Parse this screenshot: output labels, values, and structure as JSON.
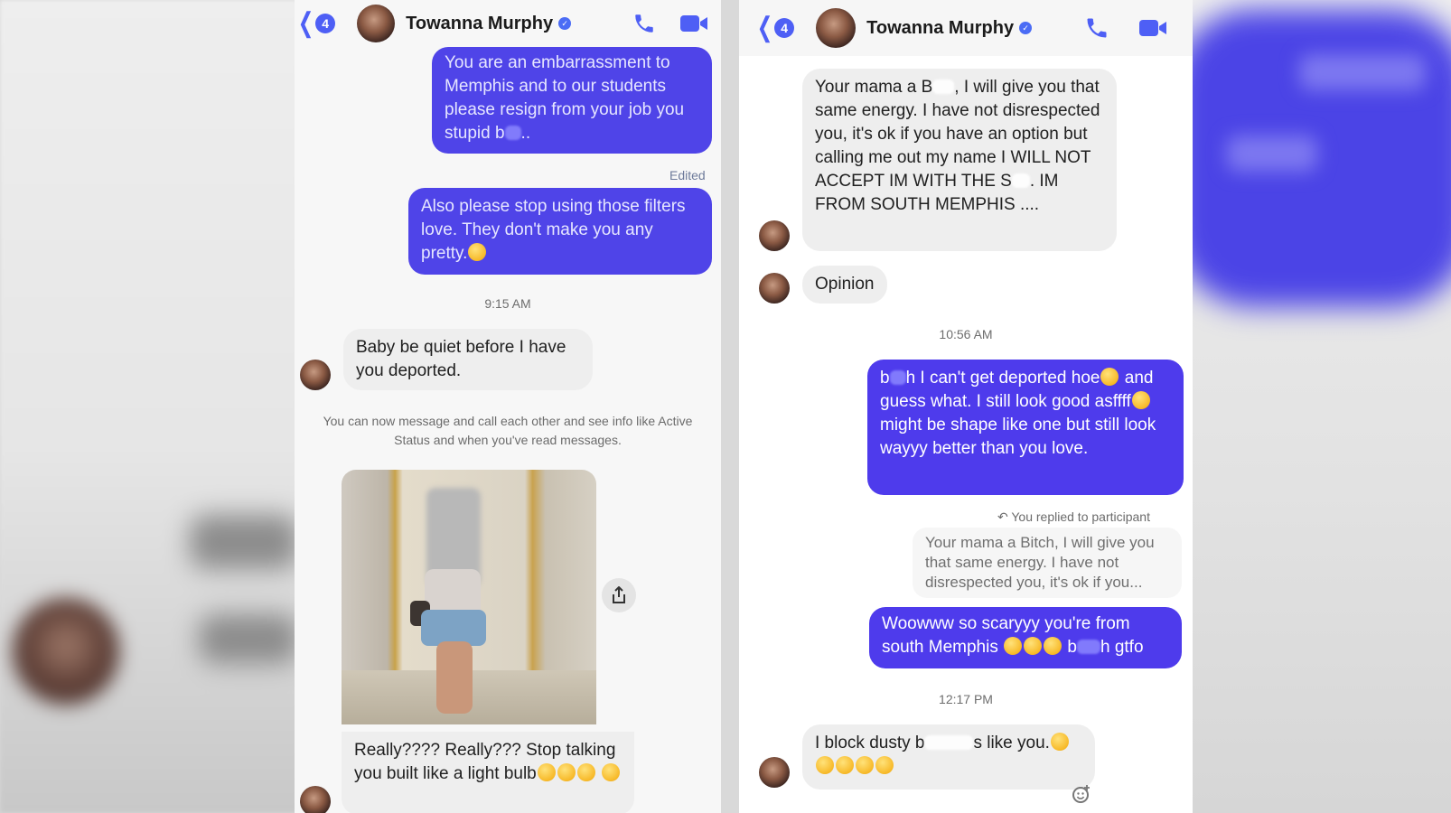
{
  "left_panel": {
    "header": {
      "back_count": "4",
      "name": "Towanna Murphy"
    },
    "messages": {
      "out1": "You are an embarrassment to Memphis and to our students please resign from your job you stupid b",
      "out1_tail": "..",
      "edited": "Edited",
      "out2": "Also please stop using those filters love. They don't make you any pretty.",
      "time1": "9:15 AM",
      "in1": "Baby be quiet before I have you deported.",
      "system_notice": "You can now message and call each other and see info like Active Status and when you've read messages.",
      "in2": "Really???? Really??? Stop talking you built like a light bulb"
    }
  },
  "right_panel": {
    "header": {
      "back_count": "4",
      "name": "Towanna Murphy"
    },
    "messages": {
      "in1_a": "Your mama a B",
      "in1_b": ", I will give you that same energy. I have not disrespected you, it's ok if you have an option but calling me out my name I WILL NOT ACCEPT IM WITH THE S",
      "in1_c": ". IM FROM SOUTH MEMPHIS ....",
      "in2": "Opinion",
      "time1": "10:56 AM",
      "out1_a": "b",
      "out1_b": "h I can't get deported hoe",
      "out1_c": "and guess what. I still look good asffff",
      "out1_d": "might be shape like one but still look wayyy better than you love.",
      "reply_meta": "You replied to participant",
      "quoted": "Your mama a Bitch, I will give you that same energy. I have not disrespected you, it's ok if you...",
      "out2_a": "Woowww so scaryyy you're from south Memphis",
      "out2_b": "b",
      "out2_c": "h gtfo",
      "time2": "12:17 PM",
      "in3_a": "I block dusty b",
      "in3_b": "s like you."
    }
  },
  "icons": [
    "chevron-left-icon",
    "phone-icon",
    "video-camera-icon",
    "verified-badge-icon",
    "share-icon",
    "add-reaction-icon"
  ],
  "colors": {
    "accent": "#4e5ff5",
    "outgoing_bubble": "#4f44e8",
    "incoming_bubble": "#eeeeee"
  }
}
